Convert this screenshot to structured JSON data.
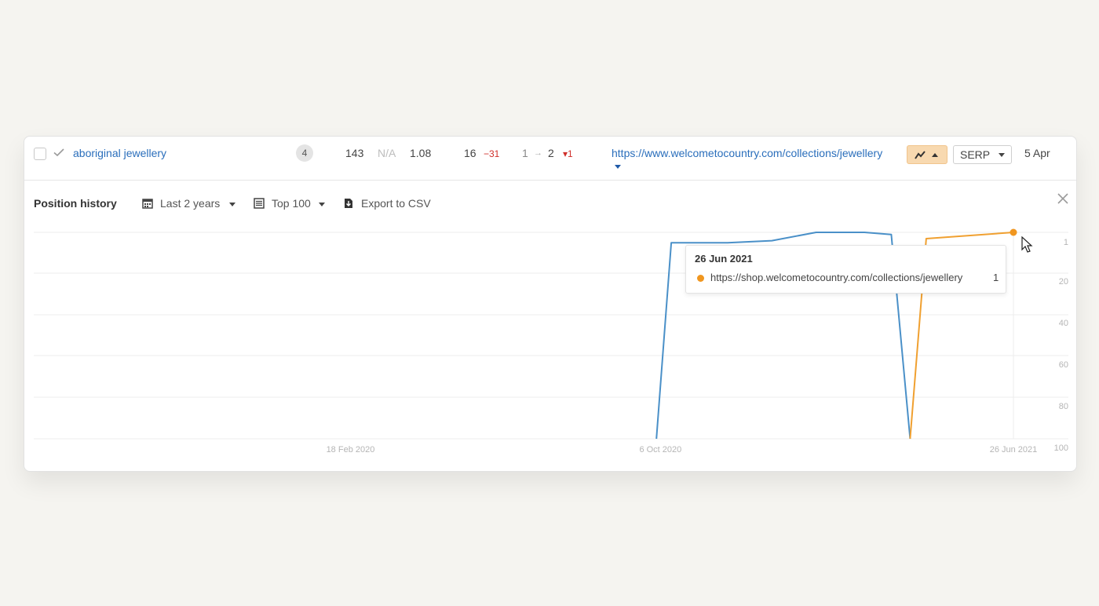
{
  "row": {
    "keyword": "aboriginal jewellery",
    "kd": "4",
    "volume": "143",
    "gv": "N/A",
    "cpc": "1.08",
    "traffic": "16",
    "traffic_change": "−31",
    "position_from": "1",
    "arrow": "→",
    "position_to": "2",
    "position_change": "▾1",
    "url": "https://www.welcometocountry.com/collections/jewellery",
    "serp_label": "SERP",
    "date": "5 Apr"
  },
  "panel": {
    "title": "Position history",
    "range_label": "Last 2 years",
    "top_label": "Top 100",
    "export_label": "Export to CSV"
  },
  "tooltip": {
    "date": "26 Jun 2021",
    "url": "https://shop.welcometocountry.com/collections/jewellery",
    "value": "1"
  },
  "colors": {
    "series_blue": "#4a90c8",
    "series_orange": "#f0a030",
    "link": "#2a6ebb",
    "negative": "#d0302b"
  },
  "chart_data": {
    "type": "line",
    "y_reversed": true,
    "ylim": [
      1,
      100
    ],
    "y_ticks": [
      "1",
      "20",
      "40",
      "60",
      "80",
      "100"
    ],
    "x_ticks": [
      "18 Feb 2020",
      "6 Oct 2020",
      "26 Jun 2021"
    ],
    "xlim": [
      "2019-06-27",
      "2021-06-26"
    ],
    "series": [
      {
        "color": "#4a90c8",
        "points": [
          [
            "2020-10-03",
            100
          ],
          [
            "2020-10-14",
            6
          ],
          [
            "2020-11-25",
            6
          ],
          [
            "2020-12-28",
            5
          ],
          [
            "2021-01-30",
            1
          ],
          [
            "2021-03-07",
            1
          ],
          [
            "2021-03-27",
            2
          ],
          [
            "2021-04-10",
            100
          ]
        ]
      },
      {
        "color": "#f0a030",
        "points": [
          [
            "2021-04-10",
            100
          ],
          [
            "2021-04-22",
            4
          ],
          [
            "2021-06-26",
            1
          ]
        ]
      }
    ],
    "highlight": {
      "date": "2021-06-26",
      "value": 1
    }
  }
}
